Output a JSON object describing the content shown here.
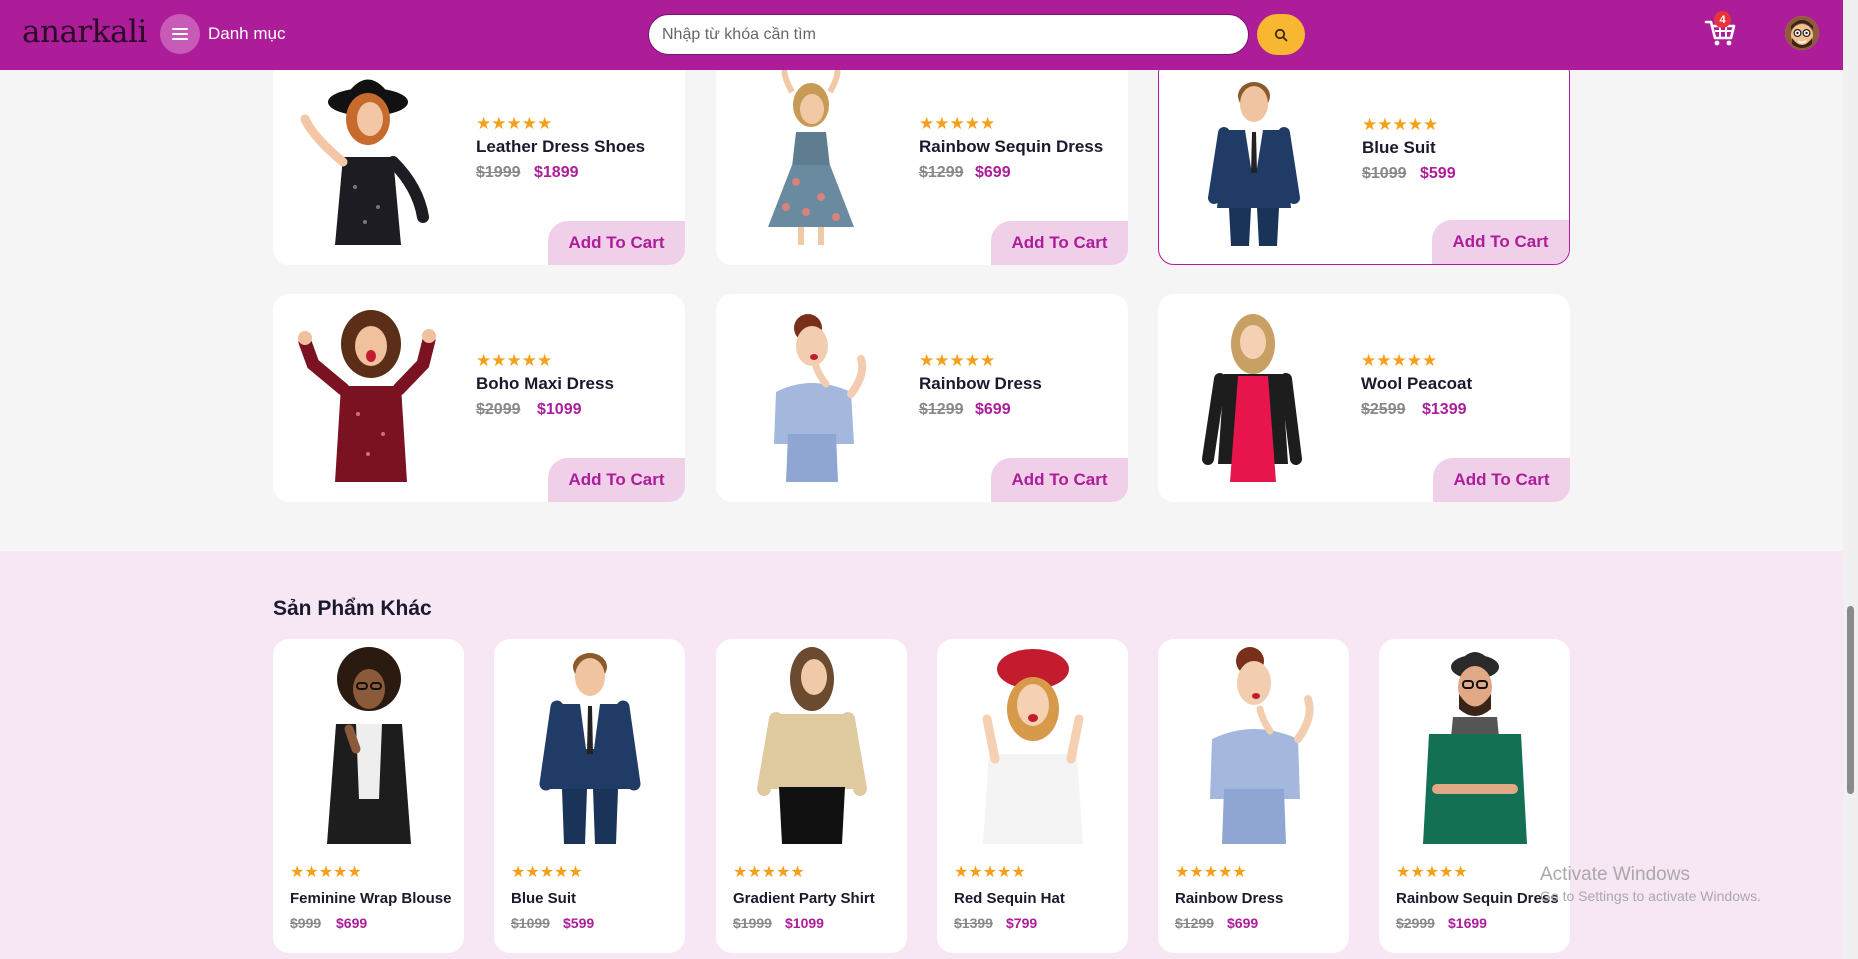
{
  "header": {
    "logo": "anarkali",
    "menu_label": "Danh mục",
    "search_placeholder": "Nhập từ khóa cần tìm",
    "cart_count": "4"
  },
  "featured_products": [
    {
      "name": "Leather Dress Shoes",
      "old_price": "$1999",
      "new_price": "$1899",
      "button": "Add To Cart",
      "stars": "★★★★★"
    },
    {
      "name": "Rainbow Sequin Dress",
      "old_price": "$1299",
      "new_price": "$699",
      "button": "Add To Cart",
      "stars": "★★★★★"
    },
    {
      "name": "Blue Suit",
      "old_price": "$1099",
      "new_price": "$599",
      "button": "Add To Cart",
      "stars": "★★★★★"
    },
    {
      "name": "Boho Maxi Dress",
      "old_price": "$2099",
      "new_price": "$1099",
      "button": "Add To Cart",
      "stars": "★★★★★"
    },
    {
      "name": "Rainbow Dress",
      "old_price": "$1299",
      "new_price": "$699",
      "button": "Add To Cart",
      "stars": "★★★★★"
    },
    {
      "name": "Wool Peacoat",
      "old_price": "$2599",
      "new_price": "$1399",
      "button": "Add To Cart",
      "stars": "★★★★★"
    }
  ],
  "other_section": {
    "title": "Sản Phẩm Khác",
    "products": [
      {
        "name": "Feminine Wrap Blouse",
        "old_price": "$999",
        "new_price": "$699",
        "stars": "★★★★★"
      },
      {
        "name": "Blue Suit",
        "old_price": "$1099",
        "new_price": "$599",
        "stars": "★★★★★"
      },
      {
        "name": "Gradient Party Shirt",
        "old_price": "$1999",
        "new_price": "$1099",
        "stars": "★★★★★"
      },
      {
        "name": "Red Sequin Hat",
        "old_price": "$1399",
        "new_price": "$799",
        "stars": "★★★★★"
      },
      {
        "name": "Rainbow Dress",
        "old_price": "$1299",
        "new_price": "$699",
        "stars": "★★★★★"
      },
      {
        "name": "Rainbow Sequin Dress",
        "old_price": "$2999",
        "new_price": "$1699",
        "stars": "★★★★★"
      }
    ]
  },
  "watermark": {
    "line1": "Activate Windows",
    "line2": "Go to Settings to activate Windows."
  },
  "colors": {
    "brand": "#ad1d9a",
    "accent": "#f7b731",
    "star": "#f59f1b",
    "button_bg": "#f0cfe9"
  }
}
